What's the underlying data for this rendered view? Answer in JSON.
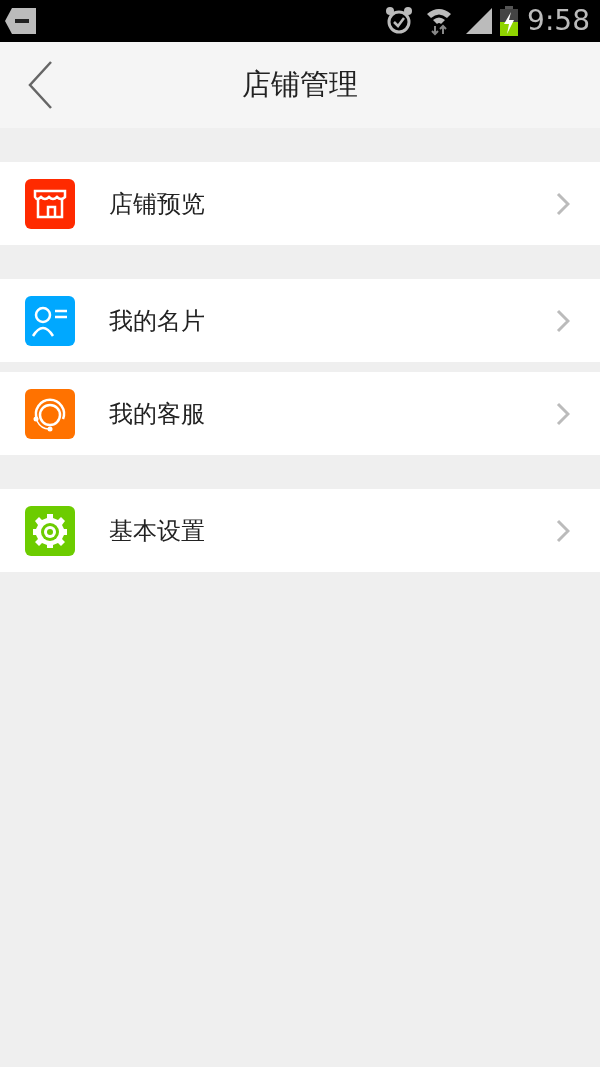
{
  "status_bar": {
    "time": "9:58"
  },
  "header": {
    "title": "店铺管理"
  },
  "groups": [
    {
      "items": [
        {
          "label": "店铺预览",
          "kind": "store",
          "color": "#ff2a00"
        }
      ]
    },
    {
      "items": [
        {
          "label": "我的名片",
          "kind": "card",
          "color": "#00a8ff"
        },
        {
          "label": "我的客服",
          "kind": "service",
          "color": "#ff7200"
        }
      ]
    },
    {
      "items": [
        {
          "label": "基本设置",
          "kind": "gear",
          "color": "#6ccc00"
        }
      ]
    }
  ]
}
